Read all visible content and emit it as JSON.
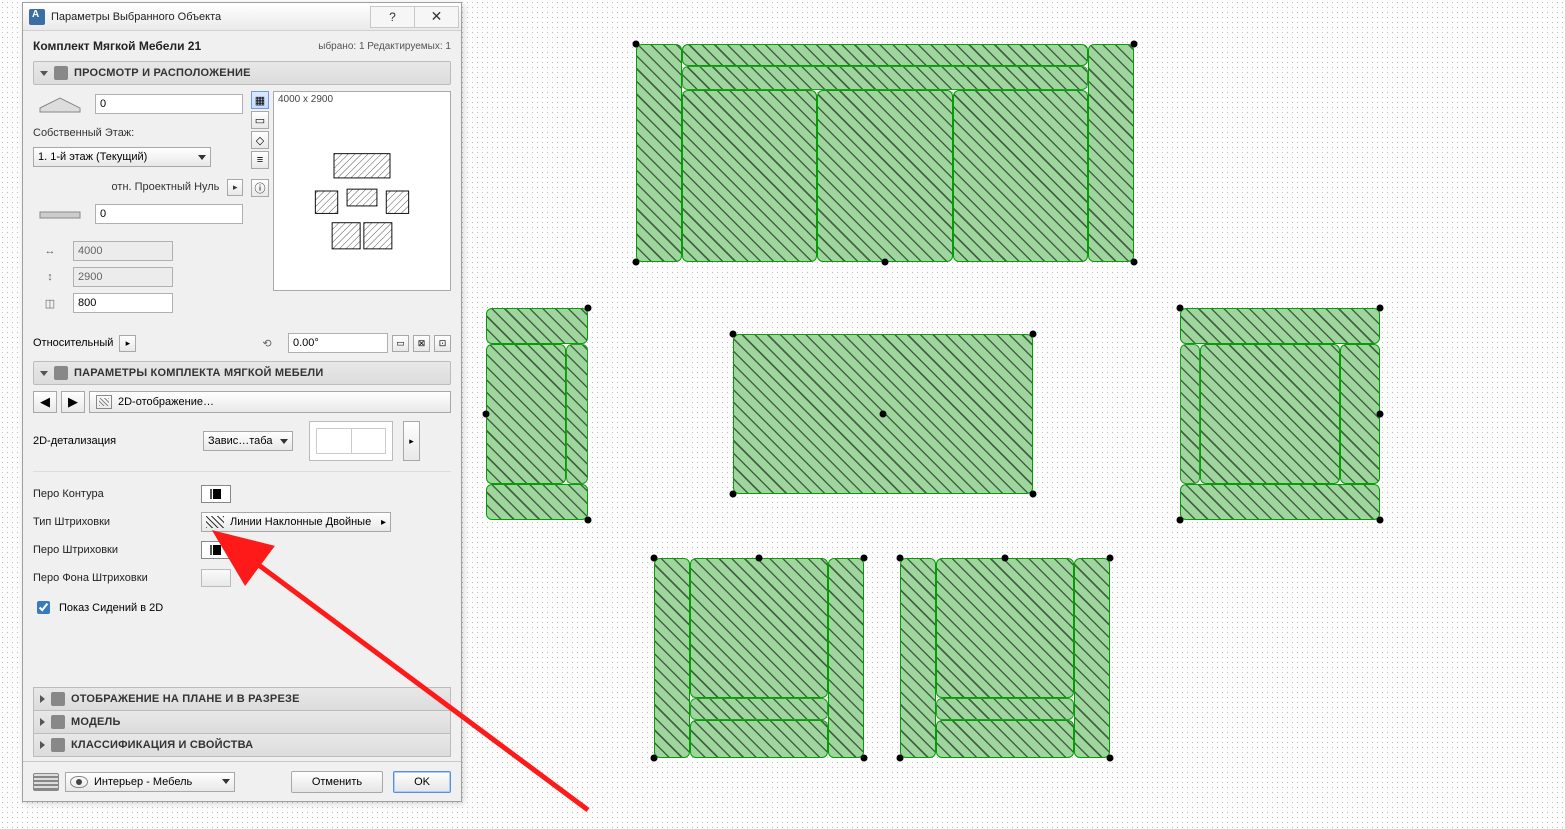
{
  "dialog": {
    "title": "Параметры Выбранного Объекта",
    "object_name": "Комплект Мягкой Мебели 21",
    "selected_editable": "ыбрано: 1 Редактируемых: 1",
    "sections": {
      "preview": "ПРОСМОТР И РАСПОЛОЖЕНИЕ",
      "params": "ПАРАМЕТРЫ КОМПЛЕКТА МЯГКОЙ МЕБЕЛИ",
      "plan": "ОТОБРАЖЕНИЕ НА ПЛАНЕ И В РАЗРЕЗЕ",
      "model": "МОДЕЛЬ",
      "class": "КЛАССИФИКАЦИЯ И СВОЙСТВА"
    },
    "elevation_top": "0",
    "own_story_label": "Собственный Этаж:",
    "story_value": "1. 1-й этаж (Текущий)",
    "project_zero_label": "отн. Проектный Нуль",
    "elevation_bottom": "0",
    "dim_a": "4000",
    "dim_b": "2900",
    "dim_c": "800",
    "preview_dims": "4000 x 2900",
    "angle_label": "Относительный",
    "angle_value": "0.00°",
    "page_label": "2D-отображение…",
    "detail_label": "2D-детализация",
    "detail_value": "Завис…таба",
    "rows": {
      "contour_pen": "Перо Контура",
      "hatch_type": "Тип Штриховки",
      "hatch_type_value": "Линии Наклонные Двойные",
      "hatch_pen": "Перо Штриховки",
      "hatch_bg_pen": "Перо Фона Штриховки",
      "show_seats": "Показ Сидений в 2D"
    },
    "footer": {
      "layer_label": "Интерьер - Мебель",
      "cancel": "Отменить",
      "ok": "OK"
    }
  }
}
